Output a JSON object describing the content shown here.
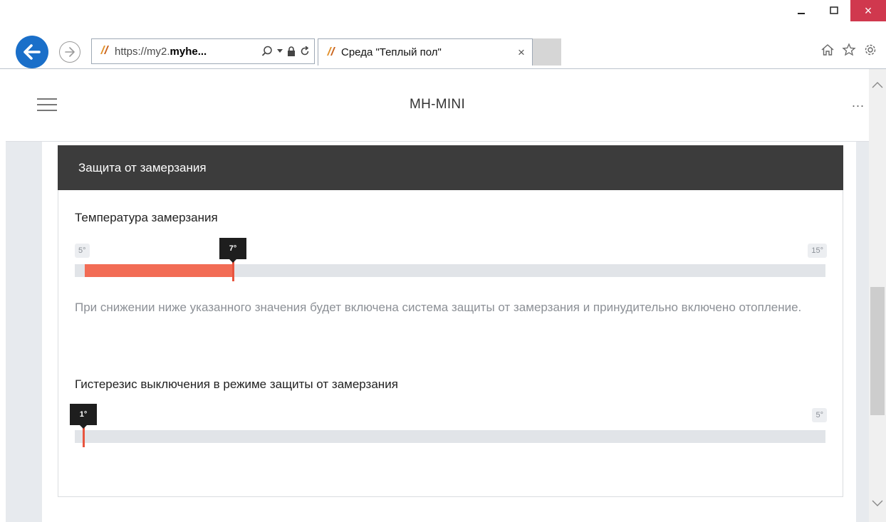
{
  "browser": {
    "address_prefix": "https://my2.",
    "address_domain": "myhe...",
    "tab_title": "Среда \"Теплый пол\"",
    "tab_close": "×",
    "window_close": "×"
  },
  "app": {
    "title": "MH-MINI",
    "more": "..."
  },
  "section": {
    "title": "Защита от замерзания"
  },
  "freeze_temp": {
    "label": "Температура замерзания",
    "min_label": "5°",
    "max_label": "15°",
    "min": 5,
    "max": 15,
    "value": 7,
    "value_label": "7°",
    "help": "При снижении ниже указанного значения будет включена система защиты от замерзания и принудительно включено отопление."
  },
  "hysteresis": {
    "label": "Гистерезис выключения в режиме защиты от замерзания",
    "max_label": "5°",
    "min": 1,
    "max": 5,
    "value": 1,
    "value_label": "1°"
  },
  "colors": {
    "accent": "#f26c55",
    "header_bg": "#3c3c3c",
    "back_button": "#1a6fc9"
  }
}
